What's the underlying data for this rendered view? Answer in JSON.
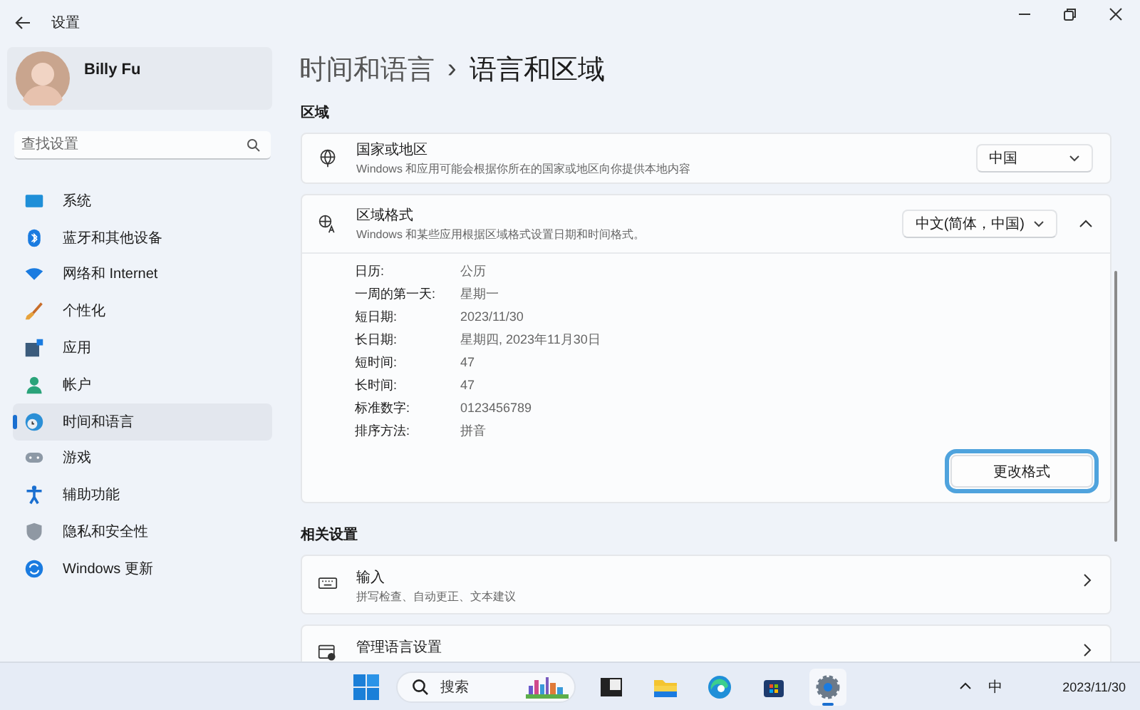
{
  "window": {
    "title": "设置"
  },
  "profile": {
    "name": "Billy Fu"
  },
  "search": {
    "placeholder": "查找设置"
  },
  "nav": [
    {
      "kind": "system",
      "label": "系统",
      "selected": false
    },
    {
      "kind": "bluetooth",
      "label": "蓝牙和其他设备",
      "selected": false
    },
    {
      "kind": "network",
      "label": "网络和 Internet",
      "selected": false
    },
    {
      "kind": "brush",
      "label": "个性化",
      "selected": false
    },
    {
      "kind": "apps",
      "label": "应用",
      "selected": false
    },
    {
      "kind": "account",
      "label": "帐户",
      "selected": false
    },
    {
      "kind": "time",
      "label": "时间和语言",
      "selected": true
    },
    {
      "kind": "game",
      "label": "游戏",
      "selected": false
    },
    {
      "kind": "access",
      "label": "辅助功能",
      "selected": false
    },
    {
      "kind": "shield",
      "label": "隐私和安全性",
      "selected": false
    },
    {
      "kind": "update",
      "label": "Windows 更新",
      "selected": false
    }
  ],
  "breadcrumb": {
    "parent": "时间和语言",
    "separator": "›",
    "current": "语言和区域"
  },
  "region": {
    "heading": "区域",
    "country": {
      "title": "国家或地区",
      "description": "Windows 和应用可能会根据你所在的国家或地区向你提供本地内容",
      "value": "中国"
    },
    "format": {
      "title": "区域格式",
      "description": "Windows 和某些应用根据区域格式设置日期和时间格式。",
      "value": "中文(简体，中国)",
      "expanded": true,
      "rows": [
        {
          "label": "日历:",
          "value": "公历"
        },
        {
          "label": "一周的第一天:",
          "value": "星期一"
        },
        {
          "label": "短日期:",
          "value": "2023/11/30"
        },
        {
          "label": "长日期:",
          "value": "星期四, 2023年11月30日"
        },
        {
          "label": "短时间:",
          "value": "47"
        },
        {
          "label": "长时间:",
          "value": "47"
        },
        {
          "label": "标准数字:",
          "value": "0123456789"
        },
        {
          "label": "排序方法:",
          "value": "拼音"
        }
      ],
      "button": {
        "label": "更改格式",
        "highlighted": true
      }
    }
  },
  "related": {
    "heading": "相关设置",
    "items": [
      {
        "kind": "keyboard",
        "title": "输入",
        "description": "拼写检查、自动更正、文本建议"
      },
      {
        "kind": "language",
        "title": "管理语言设置"
      }
    ]
  },
  "taskbar": {
    "search_placeholder": "搜索",
    "apps": [
      {
        "kind": "taskview",
        "selected": false
      },
      {
        "kind": "folder",
        "selected": false
      },
      {
        "kind": "edge",
        "selected": false
      },
      {
        "kind": "store",
        "selected": false
      },
      {
        "kind": "settings",
        "selected": true
      }
    ],
    "ime": "中",
    "date": "2023/11/30"
  }
}
